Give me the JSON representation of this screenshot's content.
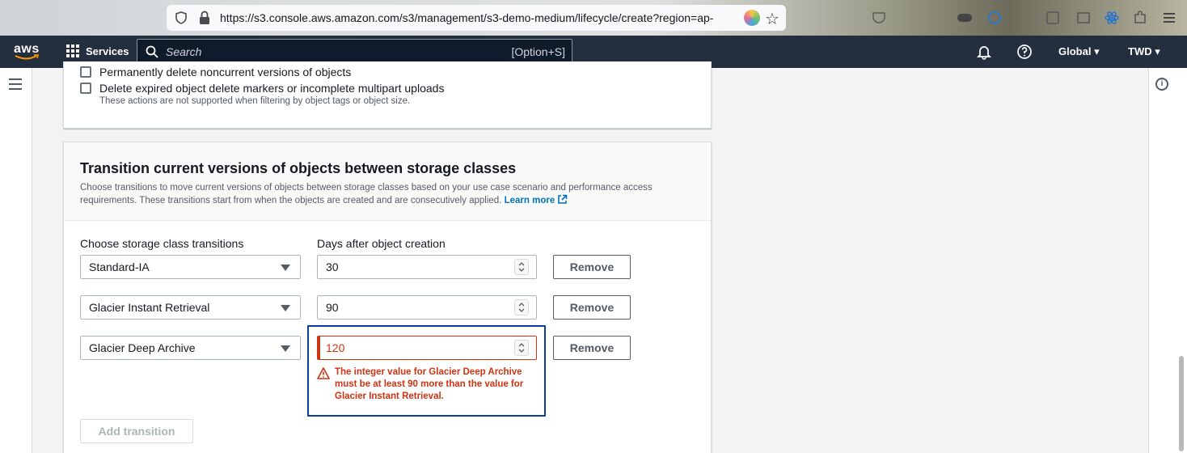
{
  "browser": {
    "url": "https://s3.console.aws.amazon.com/s3/management/s3-demo-medium/lifecycle/create?region=ap-"
  },
  "nav": {
    "logo": "aws",
    "services_label": "Services",
    "search_placeholder": "Search",
    "search_shortcut": "[Option+S]",
    "region_label": "Global",
    "account_label": "TWD"
  },
  "expiration_panel": {
    "checkbox_noncurrent": "Permanently delete noncurrent versions of objects",
    "checkbox_markers": "Delete expired object delete markers or incomplete multipart uploads",
    "hint": "These actions are not supported when filtering by object tags or object size."
  },
  "transition_panel": {
    "title": "Transition current versions of objects between storage classes",
    "description": "Choose transitions to move current versions of objects between storage classes based on your use case scenario and performance access requirements. These transitions start from when the objects are created and are consecutively applied.",
    "learn_more": "Learn more",
    "col_storage_class": "Choose storage class transitions",
    "col_days": "Days after object creation",
    "rows": [
      {
        "storage_class": "Standard-IA",
        "days": "30",
        "remove_label": "Remove"
      },
      {
        "storage_class": "Glacier Instant Retrieval",
        "days": "90",
        "remove_label": "Remove"
      },
      {
        "storage_class": "Glacier Deep Archive",
        "days": "120",
        "remove_label": "Remove"
      }
    ],
    "error_message": "The integer value for Glacier Deep Archive must be at least 90 more than the value for Glacier Instant Retrieval.",
    "add_transition_label": "Add transition"
  },
  "colors": {
    "nav_bg": "#232f3e",
    "link": "#0073bb",
    "error": "#d13212",
    "focus": "#0a3fa0"
  }
}
